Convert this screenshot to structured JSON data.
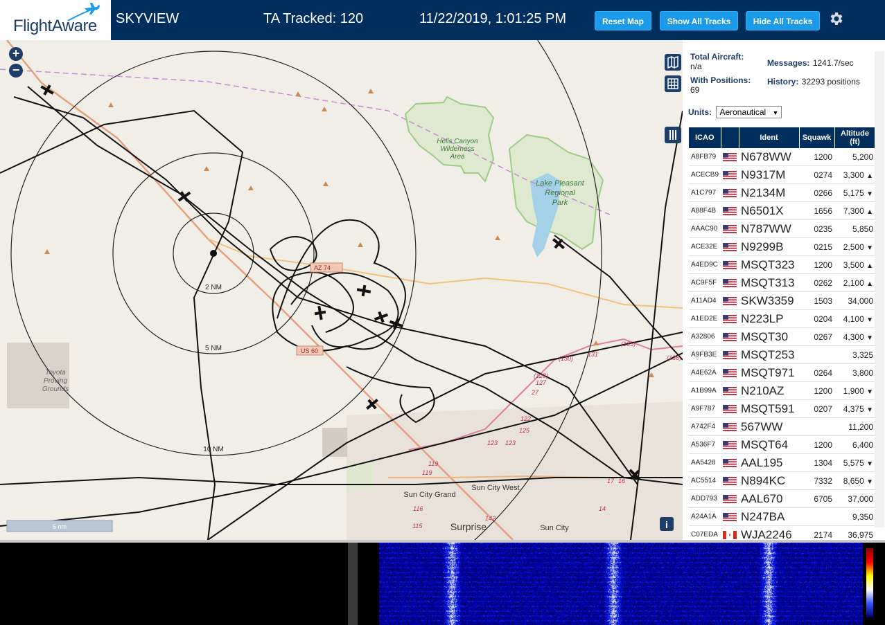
{
  "header": {
    "logo_text": "FlightAware",
    "site_name": "SKYVIEW",
    "tracked": "TA Tracked: 120",
    "datetime": "11/22/2019, 1:01:25 PM",
    "buttons": {
      "reset_map": "Reset Map",
      "show_all": "Show All Tracks",
      "hide_all": "Hide All Tracks"
    }
  },
  "stats": {
    "total_aircraft_label": "Total Aircraft:",
    "total_aircraft_value": "n/a",
    "messages_label": "Messages:",
    "messages_value": "1241.7/sec",
    "with_positions_label": "With Positions:",
    "with_positions_value": "69",
    "history_label": "History:",
    "history_value": "32293 positions"
  },
  "units": {
    "label": "Units:",
    "selected": "Aeronautical"
  },
  "table": {
    "columns": [
      "ICAO",
      "",
      "Ident",
      "Squawk",
      "Altitude (ft)"
    ],
    "rows": [
      {
        "icao": "A8FB79",
        "flag": "us",
        "ident": "N678WW",
        "squawk": "1200",
        "alt": "5,200",
        "trend": ""
      },
      {
        "icao": "ACECB9",
        "flag": "us",
        "ident": "N9317M",
        "squawk": "0274",
        "alt": "3,300",
        "trend": "▲"
      },
      {
        "icao": "A1C797",
        "flag": "us",
        "ident": "N2134M",
        "squawk": "0266",
        "alt": "5,175",
        "trend": "▼"
      },
      {
        "icao": "A88F4B",
        "flag": "us",
        "ident": "N6501X",
        "squawk": "1656",
        "alt": "7,300",
        "trend": "▲"
      },
      {
        "icao": "AAAC90",
        "flag": "us",
        "ident": "N787WW",
        "squawk": "0235",
        "alt": "5,850",
        "trend": ""
      },
      {
        "icao": "ACE32E",
        "flag": "us",
        "ident": "N9299B",
        "squawk": "0215",
        "alt": "2,500",
        "trend": "▼"
      },
      {
        "icao": "A4ED9C",
        "flag": "us",
        "ident": "MSQT323",
        "squawk": "1200",
        "alt": "3,500",
        "trend": "▲"
      },
      {
        "icao": "AC9F5F",
        "flag": "us",
        "ident": "MSQT313",
        "squawk": "0262",
        "alt": "2,100",
        "trend": "▲"
      },
      {
        "icao": "A11AD4",
        "flag": "us",
        "ident": "SKW3359",
        "squawk": "1503",
        "alt": "34,000",
        "trend": ""
      },
      {
        "icao": "A1ED2E",
        "flag": "us",
        "ident": "N223LP",
        "squawk": "0204",
        "alt": "4,100",
        "trend": "▼"
      },
      {
        "icao": "A32806",
        "flag": "us",
        "ident": "MSQT30",
        "squawk": "0267",
        "alt": "4,300",
        "trend": "▼"
      },
      {
        "icao": "A9FB3E",
        "flag": "us",
        "ident": "MSQT253",
        "squawk": "",
        "alt": "3,325",
        "trend": ""
      },
      {
        "icao": "A4E62A",
        "flag": "us",
        "ident": "MSQT971",
        "squawk": "0264",
        "alt": "3,800",
        "trend": ""
      },
      {
        "icao": "A1B99A",
        "flag": "us",
        "ident": "N210AZ",
        "squawk": "1200",
        "alt": "1,900",
        "trend": "▼"
      },
      {
        "icao": "A9F787",
        "flag": "us",
        "ident": "MSQT591",
        "squawk": "0207",
        "alt": "4,375",
        "trend": "▼"
      },
      {
        "icao": "A742F4",
        "flag": "us",
        "ident": "567WW",
        "squawk": "",
        "alt": "11,200",
        "trend": ""
      },
      {
        "icao": "A536F7",
        "flag": "us",
        "ident": "MSQT64",
        "squawk": "1200",
        "alt": "6,400",
        "trend": ""
      },
      {
        "icao": "AA5428",
        "flag": "us",
        "ident": "AAL195",
        "squawk": "1304",
        "alt": "5,575",
        "trend": "▼"
      },
      {
        "icao": "AC5514",
        "flag": "us",
        "ident": "N894KC",
        "squawk": "7332",
        "alt": "8,650",
        "trend": "▼"
      },
      {
        "icao": "ADD793",
        "flag": "us",
        "ident": "AAL670",
        "squawk": "6705",
        "alt": "37,000",
        "trend": ""
      },
      {
        "icao": "A24A1A",
        "flag": "us",
        "ident": "N247BA",
        "squawk": "",
        "alt": "9,350",
        "trend": ""
      },
      {
        "icao": "C07EDA",
        "flag": "ca",
        "ident": "WJA2246",
        "squawk": "2174",
        "alt": "36,975",
        "trend": ""
      }
    ]
  },
  "map": {
    "range_labels": [
      "2 NM",
      "5 NM",
      "10 NM"
    ],
    "place_labels": {
      "hells_canyon": [
        "Hells Canyon",
        "Wilderness",
        "Area"
      ],
      "lake_pleasant": [
        "Lake Pleasant",
        "Regional",
        "Park"
      ],
      "toyota": [
        "Toyota",
        "Proving",
        "Grounds"
      ],
      "sun_city_grand": "Sun City Grand",
      "sun_city_west": "Sun City West",
      "surprise": "Surprise",
      "sun_city": "Sun City"
    },
    "road_labels": [
      "AZ 74",
      "US 60"
    ],
    "route_numbers": [
      "(135)",
      "(130)",
      "131",
      "(136)",
      "(128)",
      "127",
      "27",
      "122",
      "125",
      "123",
      "123",
      "119",
      "119",
      "116",
      "115",
      "142",
      "14",
      "17",
      "16"
    ],
    "scale_label": "5 nm",
    "info_label": "i"
  },
  "colors": {
    "header_bg": "#002f5d",
    "button_bg": "#1a9ae8",
    "table_header_bg": "#002f5d"
  },
  "icons": [
    "zoom-in-icon",
    "zoom-out-icon",
    "map-layers-icon",
    "grid-icon",
    "columns-icon",
    "gear-icon",
    "info-icon"
  ]
}
